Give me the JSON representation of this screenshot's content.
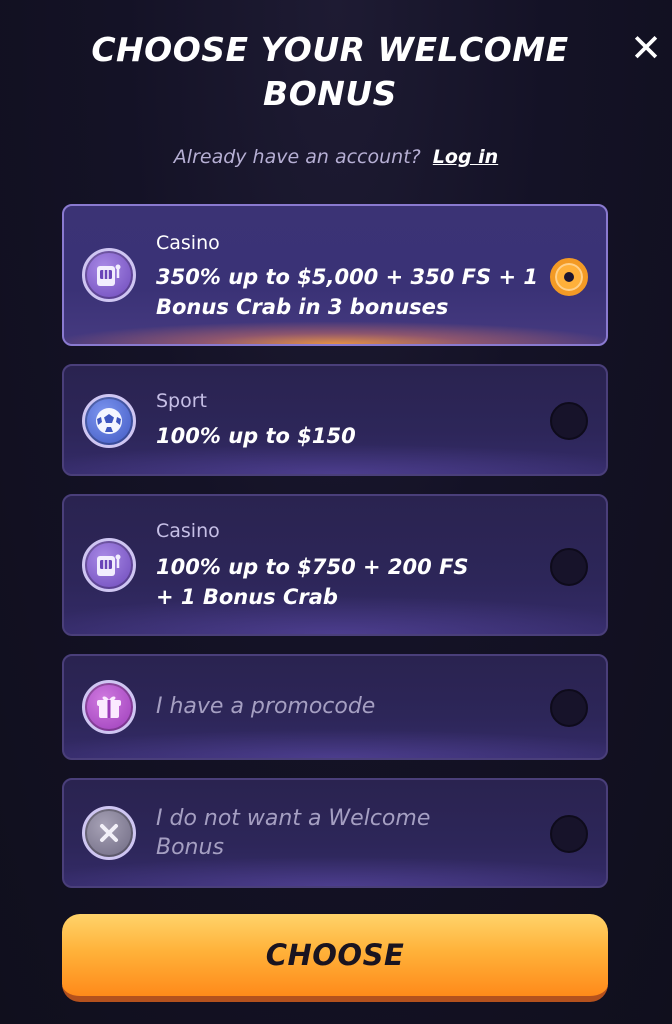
{
  "header": {
    "title_line1": "CHOOSE YOUR WELCOME",
    "title_line2": "BONUS",
    "close_icon": "close-icon"
  },
  "login": {
    "question": "Already have an account?",
    "link_label": "Log in"
  },
  "options": [
    {
      "category": "Casino",
      "offer_line1": "350% up to $5,000 + 350 FS + 1",
      "offer_line2": "Bonus Crab in 3 bonuses",
      "icon": "slot-machine-icon",
      "selected": true
    },
    {
      "category": "Sport",
      "offer_line1": "100% up to $150",
      "icon": "soccer-ball-icon",
      "selected": false
    },
    {
      "category": "Casino",
      "offer_line1": "100% up to $750 + 200 FS",
      "offer_line2": "+ 1 Bonus Crab",
      "icon": "slot-machine-icon",
      "selected": false
    },
    {
      "label": "I have a promocode",
      "icon": "gift-icon",
      "selected": false
    },
    {
      "label_line1": "I do not want a Welcome",
      "label_line2": "Bonus",
      "icon": "x-circle-icon",
      "selected": false
    }
  ],
  "action": {
    "choose_label": "CHOOSE"
  },
  "colors": {
    "accent": "#ffb23a",
    "card_border": "#4a3f7a",
    "background": "#141226"
  }
}
